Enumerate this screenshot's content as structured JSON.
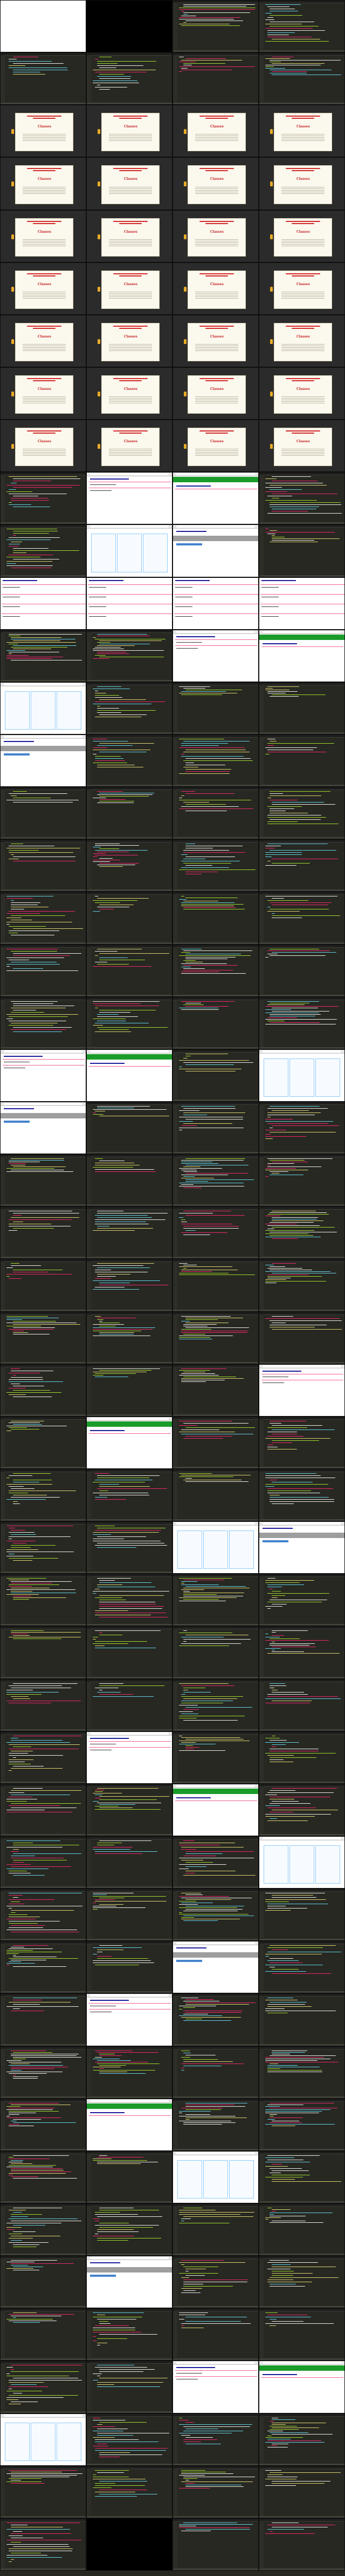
{
  "sheet": {
    "type": "video-thumbnail-contact-sheet",
    "columns": 4,
    "rows": 49,
    "slide_text": "Classes",
    "tile_kinds": [
      "editor",
      "video",
      "slide",
      "browser",
      "gutter",
      "pink"
    ],
    "colors": {
      "editor_background": "#272822",
      "editor_pink": "#f92672",
      "editor_green": "#a6e22e",
      "editor_yellow": "#e6db74",
      "editor_blue": "#66d9ef",
      "editor_white": "#f8f8f2",
      "slide_red": "#c62828",
      "browser_heading": "#1d1d9c",
      "browser_rule": "#f06292",
      "browser_banner": "#1a9c2a"
    }
  }
}
